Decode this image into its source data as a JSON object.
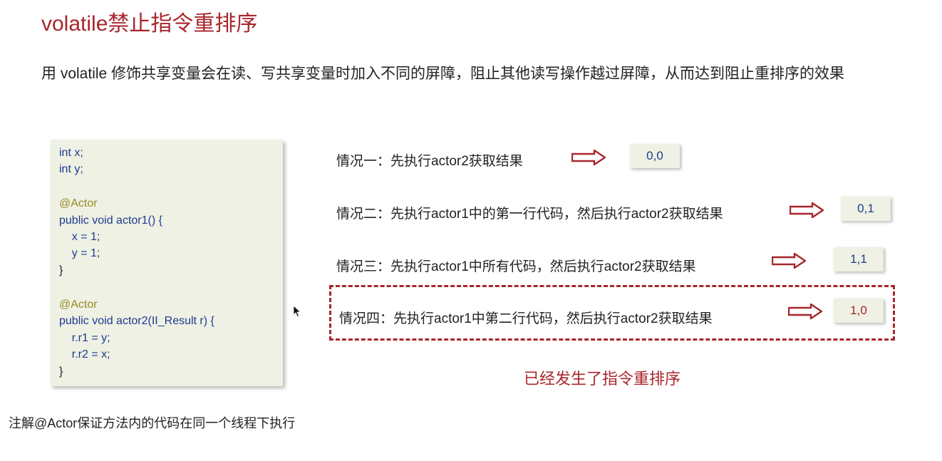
{
  "title": "volatile禁止指令重排序",
  "intro": "用 volatile 修饰共享变量会在读、写共享变量时加入不同的屏障，阻止其他读写操作越过屏障，从而达到阻止重排序的效果",
  "code": {
    "lines": [
      "int x;",
      "int y;",
      "",
      "@Actor",
      "public void actor1() {",
      "    x = 1;",
      "    y = 1;",
      "}",
      "",
      "@Actor",
      "public void actor2(II_Result r) {",
      "    r.r1 = y;",
      "    r.r2 = x;",
      "}"
    ]
  },
  "cases": [
    {
      "label": "情况一：先执行actor2获取结果",
      "result": "0,0"
    },
    {
      "label": "情况二：先执行actor1中的第一行代码，然后执行actor2获取结果",
      "result": "0,1"
    },
    {
      "label": "情况三：先执行actor1中所有代码，然后执行actor2获取结果",
      "result": "1,1"
    },
    {
      "label": "情况四：先执行actor1中第二行代码，然后执行actor2获取结果",
      "result": "1,0"
    }
  ],
  "happened": "已经发生了指令重排序",
  "note": "注解@Actor保证方法内的代码在同一个线程下执行",
  "colors": {
    "accent_red": "#a8262c",
    "code_bg": "#eef1e3",
    "code_text": "#1f3a93",
    "annotation": "#9a8a26"
  }
}
